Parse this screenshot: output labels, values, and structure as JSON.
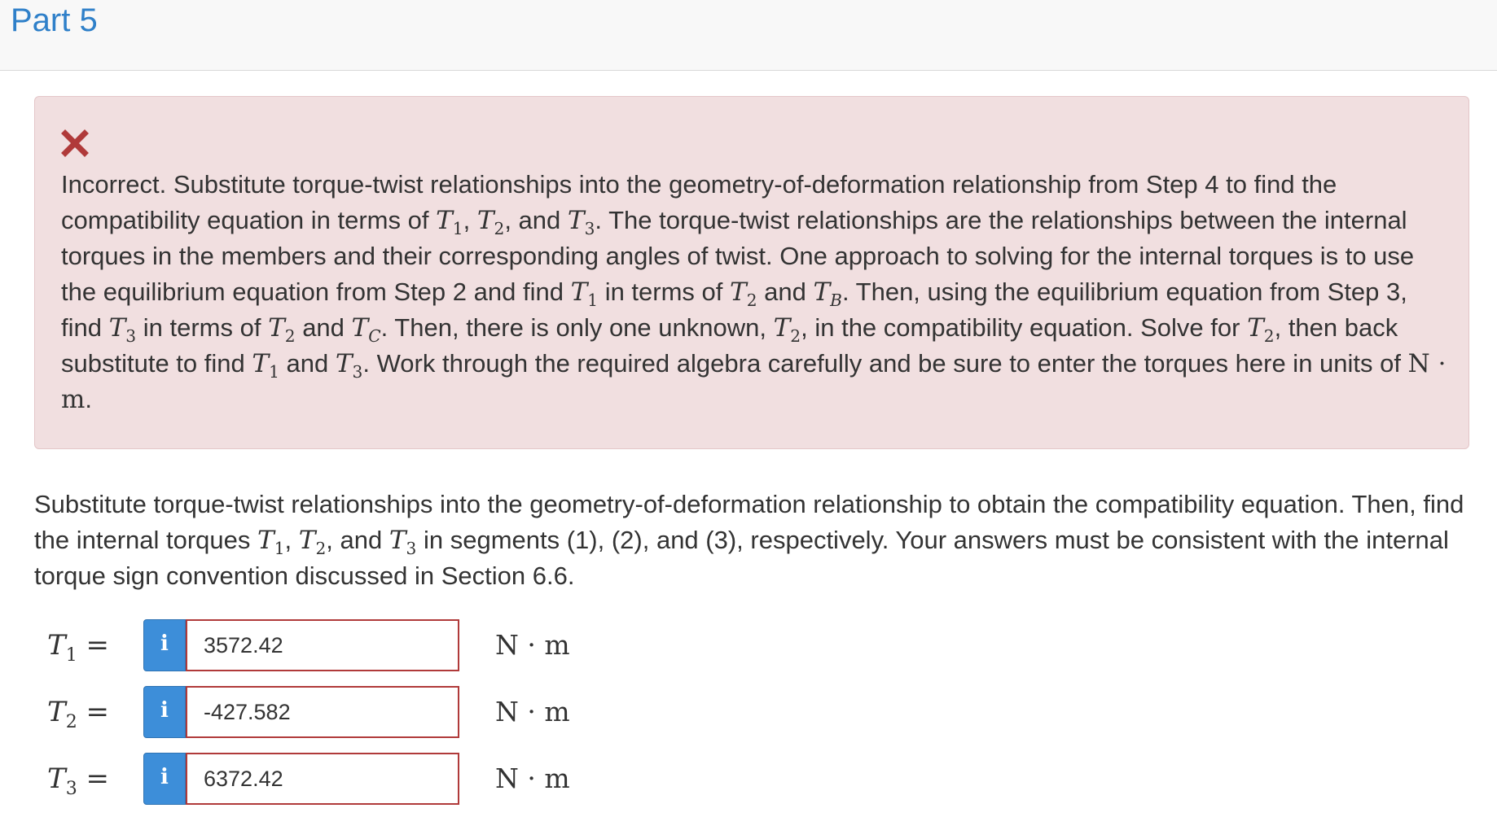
{
  "part": {
    "title": "Part 5"
  },
  "feedback": {
    "icon": "close-icon",
    "status_color": "#b03a3a",
    "lines": {
      "s1": "Incorrect. Substitute torque-twist relationships into the geometry-of-deformation relationship from Step 4 to find the compatibility equation in terms of ",
      "T": "T",
      "n1": "1",
      "n2": "2",
      "n3": "3",
      "B": "B",
      "C": "C",
      "comma": ", ",
      "and": ", and ",
      "s2": ". The torque-twist relationships are the relationships between the internal torques in the members and their corresponding angles of twist. One approach to solving for the internal torques is to use the equilibrium equation from Step 2 and find ",
      "s3": " in terms of ",
      "and2": " and ",
      "s4": ". Then, using the equilibrium equation from Step 3, find ",
      "s5": ". Then, there is only one unknown, ",
      "s6": ", in the compatibility equation. Solve for ",
      "s7": ", then back substitute to find ",
      "s8": ". Work through the required algebra carefully and be sure to enter the torques here in units of ",
      "unit": "N · m",
      "end": "."
    }
  },
  "prompt": {
    "s1": "Substitute torque-twist relationships into the geometry-of-deformation relationship to obtain the compatibility equation. Then, find the internal torques ",
    "T": "T",
    "n1": "1",
    "n2": "2",
    "n3": "3",
    "comma": ", ",
    "and": ", and ",
    "s2": " in segments (1), (2), and (3), respectively. Your answers must be consistent with the internal torque sign convention discussed in Section 6.6."
  },
  "answers": [
    {
      "var": "T",
      "sub": "1",
      "eq": " =",
      "info": "i",
      "value": "3572.42",
      "unit": "N · m"
    },
    {
      "var": "T",
      "sub": "2",
      "eq": " =",
      "info": "i",
      "value": "-427.582",
      "unit": "N · m"
    },
    {
      "var": "T",
      "sub": "3",
      "eq": " =",
      "info": "i",
      "value": "6372.42",
      "unit": "N · m"
    }
  ],
  "colors": {
    "accent": "#2f80c9",
    "error_bg": "#f1dfe0",
    "info_button": "#3d8ed9",
    "input_border": "#b03a3a"
  }
}
